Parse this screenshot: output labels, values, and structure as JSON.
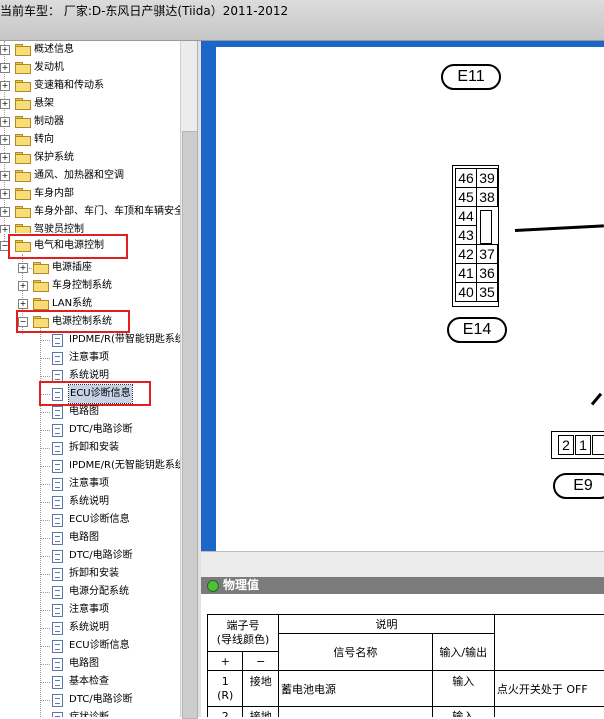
{
  "header": {
    "title": "当前车型： 厂家:D-东风日产骐达(Tiida）2011-2012"
  },
  "tree": {
    "top_items": [
      "概述信息",
      "发动机",
      "变速箱和传动系",
      "悬架",
      "制动器",
      "转向",
      "保护系统",
      "通风、加热器和空调",
      "车身内部",
      "车身外部、车门、车顶和车辆安全",
      "驾驶员控制"
    ],
    "expanded_item": "电气和电源控制",
    "sub_items": [
      "电源插座",
      "车身控制系统",
      "LAN系统"
    ],
    "open_sub": "电源控制系统",
    "docs": [
      "IPDME/R(带智能钥匙系统)",
      "注意事项",
      "系统说明",
      "ECU诊断信息",
      "电路图",
      "DTC/电路诊断",
      "拆卸和安装",
      "IPDME/R(无智能钥匙系统)",
      "注意事项",
      "系统说明",
      "ECU诊断信息",
      "电路图",
      "DTC/电路诊断",
      "拆卸和安装",
      "电源分配系统",
      "注意事项",
      "系统说明",
      "ECU诊断信息",
      "电路图",
      "基本检查",
      "DTC/电路诊断",
      "症状诊断"
    ],
    "selected": "ECU诊断信息"
  },
  "diagram": {
    "connectors": {
      "top": "E11",
      "main": "E14",
      "right": "E9"
    },
    "e14_pins": [
      [
        "46",
        "39"
      ],
      [
        "45",
        "38"
      ],
      [
        "44",
        ""
      ],
      [
        "43",
        ""
      ],
      [
        "42",
        "37"
      ],
      [
        "41",
        "36"
      ],
      [
        "40",
        "35"
      ]
    ],
    "e9_pins": [
      "2",
      "1"
    ]
  },
  "section": {
    "title": "物理值"
  },
  "table": {
    "h_terminal": "端子号",
    "h_wire": "(导线颜色)",
    "h_desc": "说明",
    "h_signal": "信号名称",
    "h_io": "输入/输出",
    "h_plus": "+",
    "h_minus": "−",
    "row1": {
      "plus": "1",
      "plus_color": "(R)",
      "minus": "接地",
      "signal": "蓄电池电源",
      "io": "输入",
      "cond": "点火开关处于 OFF"
    },
    "row2": {
      "plus": "2",
      "minus": "接地",
      "io": "输入"
    }
  },
  "colors": {
    "frame": "#1a66c9",
    "highlight": "#e02020"
  }
}
